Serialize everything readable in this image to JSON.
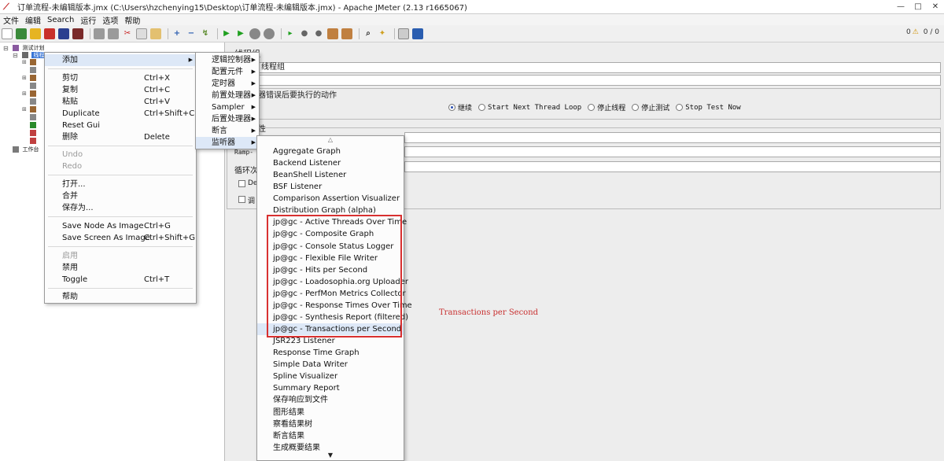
{
  "window": {
    "title": "订单流程-未编辑版本.jmx (C:\\Users\\hzchenying15\\Desktop\\订单流程-未编辑版本.jmx) - Apache JMeter (2.13 r1665067)",
    "controls": [
      "—",
      "□",
      "✕"
    ]
  },
  "menubar": [
    "文件",
    "编辑",
    "Search",
    "运行",
    "选项",
    "帮助"
  ],
  "toolbar_status": {
    "warnings": "0",
    "counter": "0 / 0"
  },
  "tree": {
    "root": "测试计划",
    "selected": "线程组",
    "workbench": "工作台"
  },
  "right_panel": {
    "section_title": "线程组",
    "name_value": "线程组",
    "on_error_label": "器错误后要执行的动作",
    "actions": [
      "继续",
      "Start Next Thread Loop",
      "停止线程",
      "停止测试",
      "Stop Test Now"
    ],
    "props_label": "性",
    "ramp_label": "Ramp-",
    "loop_label": "循环次",
    "delay_label": "De",
    "scheduler_label": "调"
  },
  "context_menu": {
    "items": [
      {
        "label": "添加",
        "shortcut": "",
        "arrow": true
      },
      {
        "label": "剪切",
        "shortcut": "Ctrl+X"
      },
      {
        "label": "复制",
        "shortcut": "Ctrl+C"
      },
      {
        "label": "粘贴",
        "shortcut": "Ctrl+V"
      },
      {
        "label": "Duplicate",
        "shortcut": "Ctrl+Shift+C"
      },
      {
        "label": "Reset Gui",
        "shortcut": ""
      },
      {
        "label": "删除",
        "shortcut": "Delete"
      },
      {
        "label": "Undo",
        "shortcut": ""
      },
      {
        "label": "Redo",
        "shortcut": ""
      },
      {
        "label": "打开...",
        "shortcut": ""
      },
      {
        "label": "合并",
        "shortcut": ""
      },
      {
        "label": "保存为...",
        "shortcut": ""
      },
      {
        "label": "Save Node As Image",
        "shortcut": "Ctrl+G"
      },
      {
        "label": "Save Screen As Image",
        "shortcut": "Ctrl+Shift+G"
      },
      {
        "label": "启用",
        "shortcut": ""
      },
      {
        "label": "禁用",
        "shortcut": ""
      },
      {
        "label": "Toggle",
        "shortcut": "Ctrl+T"
      },
      {
        "label": "帮助",
        "shortcut": ""
      }
    ]
  },
  "add_submenu": [
    "逻辑控制器",
    "配置元件",
    "定时器",
    "前置处理器",
    "Sampler",
    "后置处理器",
    "断言",
    "监听器"
  ],
  "listener_submenu": {
    "up_arrow": "△",
    "down_arrow": "▼",
    "items": [
      "Aggregate Graph",
      "Backend Listener",
      "BeanShell Listener",
      "BSF Listener",
      "Comparison Assertion Visualizer",
      "Distribution Graph (alpha)",
      "jp@gc - Active Threads Over Time",
      "jp@gc - Composite Graph",
      "jp@gc - Console Status Logger",
      "jp@gc - Flexible File Writer",
      "jp@gc - Hits per Second",
      "jp@gc - Loadosophia.org Uploader",
      "jp@gc - PerfMon Metrics Collector",
      "jp@gc - Response Times Over Time",
      "jp@gc - Synthesis Report (filtered)",
      "jp@gc - Transactions per Second",
      "JSR223 Listener",
      "Response Time Graph",
      "Simple Data Writer",
      "Spline Visualizer",
      "Summary Report",
      "保存响应到文件",
      "图形结果",
      "察看结果树",
      "断言结果",
      "生成概要结果"
    ]
  },
  "annotation": "Transactions per Second",
  "colors": {
    "annotation": "#d83030",
    "selection": "#3875d7"
  }
}
